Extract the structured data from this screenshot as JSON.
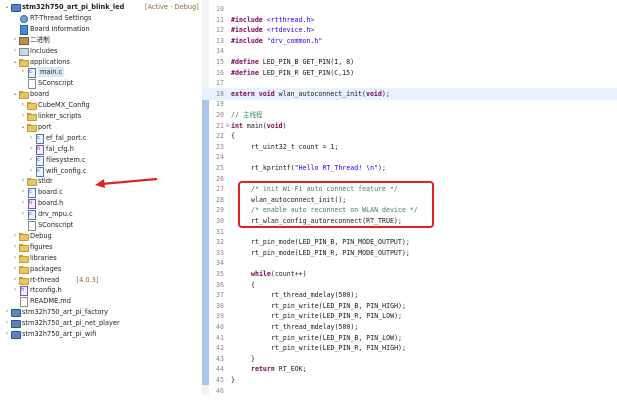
{
  "colors": {
    "selection": "#dbe7f5",
    "annotation_red": "#e02121",
    "keyword": "#7f0055",
    "string": "#2a00ff",
    "comment": "#3f7f5f",
    "current_line": "#e8f2fe"
  },
  "explorer": {
    "rows": [
      {
        "depth": 0,
        "twisty": "open",
        "icon": "project-icon",
        "label": "stm32h750_art_pi_blink_led",
        "extra": "[Active - Debug]",
        "bold": true
      },
      {
        "depth": 1,
        "twisty": "",
        "icon": "gear-icon",
        "label": "RT-Thread Settings"
      },
      {
        "depth": 1,
        "twisty": "",
        "icon": "book-icon",
        "label": "Board Information"
      },
      {
        "depth": 1,
        "twisty": "closed",
        "icon": "binaries-icon",
        "label": "二进制"
      },
      {
        "depth": 1,
        "twisty": "closed",
        "icon": "includes-icon",
        "label": "Includes"
      },
      {
        "depth": 1,
        "twisty": "open",
        "icon": "folder-icon",
        "label": "applications"
      },
      {
        "depth": 2,
        "twisty": "closed",
        "icon": "c-file-icon",
        "label": "main.c",
        "selected": true
      },
      {
        "depth": 2,
        "twisty": "",
        "icon": "file-icon",
        "label": "SConscript"
      },
      {
        "depth": 1,
        "twisty": "open",
        "icon": "folder-icon",
        "label": "board"
      },
      {
        "depth": 2,
        "twisty": "closed",
        "icon": "folder-icon",
        "label": "CubeMX_Config"
      },
      {
        "depth": 2,
        "twisty": "closed",
        "icon": "folder-icon",
        "label": "linker_scripts"
      },
      {
        "depth": 2,
        "twisty": "open",
        "icon": "folder-icon",
        "label": "port"
      },
      {
        "depth": 3,
        "twisty": "closed",
        "icon": "c-file-icon",
        "label": "ef_fal_port.c"
      },
      {
        "depth": 3,
        "twisty": "closed",
        "icon": "h-file-icon",
        "label": "fal_cfg.h"
      },
      {
        "depth": 3,
        "twisty": "closed",
        "icon": "c-file-icon",
        "label": "filesystem.c"
      },
      {
        "depth": 3,
        "twisty": "closed",
        "icon": "c-file-icon",
        "label": "wifi_config.c"
      },
      {
        "depth": 2,
        "twisty": "closed",
        "icon": "folder-icon",
        "label": "stldr"
      },
      {
        "depth": 2,
        "twisty": "closed",
        "icon": "c-file-icon",
        "label": "board.c"
      },
      {
        "depth": 2,
        "twisty": "closed",
        "icon": "h-file-icon",
        "label": "board.h"
      },
      {
        "depth": 2,
        "twisty": "closed",
        "icon": "c-file-icon",
        "label": "drv_mpu.c"
      },
      {
        "depth": 2,
        "twisty": "",
        "icon": "file-icon",
        "label": "SConscript"
      },
      {
        "depth": 1,
        "twisty": "closed",
        "icon": "folder-icon",
        "label": "Debug"
      },
      {
        "depth": 1,
        "twisty": "closed",
        "icon": "folder-icon",
        "label": "figures"
      },
      {
        "depth": 1,
        "twisty": "closed",
        "icon": "folder-icon",
        "label": "libraries"
      },
      {
        "depth": 1,
        "twisty": "closed",
        "icon": "folder-icon",
        "label": "packages"
      },
      {
        "depth": 1,
        "twisty": "closed",
        "icon": "folder-icon",
        "label": "rt-thread",
        "extra": "[4.0.3]"
      },
      {
        "depth": 1,
        "twisty": "closed",
        "icon": "h-file-icon",
        "label": "rtconfig.h"
      },
      {
        "depth": 1,
        "twisty": "",
        "icon": "file-icon",
        "label": "README.md"
      },
      {
        "depth": 0,
        "twisty": "closed",
        "icon": "project-icon",
        "label": "stm32h750_art_pi_factory"
      },
      {
        "depth": 0,
        "twisty": "closed",
        "icon": "project-icon",
        "label": "stm32h750_art_pi_net_player"
      },
      {
        "depth": 0,
        "twisty": "closed",
        "icon": "project-icon",
        "label": "stm32h750_art_pi_wifi"
      }
    ]
  },
  "editor": {
    "lines": [
      {
        "n": "10",
        "fold": "",
        "indent": 0,
        "parts": []
      },
      {
        "n": "11",
        "fold": "",
        "indent": 0,
        "parts": [
          {
            "t": "#include ",
            "c": "kw"
          },
          {
            "t": "<rtthread.h>",
            "c": "str"
          }
        ]
      },
      {
        "n": "12",
        "fold": "",
        "indent": 0,
        "parts": [
          {
            "t": "#include ",
            "c": "kw"
          },
          {
            "t": "<rtdevice.h>",
            "c": "str"
          }
        ]
      },
      {
        "n": "13",
        "fold": "",
        "indent": 0,
        "parts": [
          {
            "t": "#include ",
            "c": "kw"
          },
          {
            "t": "\"drv_common.h\"",
            "c": "str"
          }
        ]
      },
      {
        "n": "14",
        "fold": "",
        "indent": 0,
        "parts": []
      },
      {
        "n": "15",
        "fold": "",
        "indent": 0,
        "parts": [
          {
            "t": "#define ",
            "c": "kw"
          },
          {
            "t": "LED_PIN_B GET_PIN(I, 8)",
            "c": ""
          }
        ]
      },
      {
        "n": "16",
        "fold": "",
        "indent": 0,
        "parts": [
          {
            "t": "#define ",
            "c": "kw"
          },
          {
            "t": "LED_PIN_R GET_PIN(C,15)",
            "c": ""
          }
        ]
      },
      {
        "n": "17",
        "fold": "",
        "indent": 0,
        "parts": []
      },
      {
        "n": "18",
        "fold": "",
        "indent": 0,
        "current": true,
        "parts": [
          {
            "t": "extern void ",
            "c": "kw"
          },
          {
            "t": "wlan_autoconnect_init(",
            "c": ""
          },
          {
            "t": "void",
            "c": "kw"
          },
          {
            "t": ");",
            "c": ""
          }
        ]
      },
      {
        "n": "19",
        "fold": "",
        "indent": 0,
        "parts": []
      },
      {
        "n": "20",
        "fold": "",
        "indent": 0,
        "parts": [
          {
            "t": "// 主线程",
            "c": "cmt"
          }
        ]
      },
      {
        "n": "21",
        "fold": "⊖",
        "indent": 0,
        "parts": [
          {
            "t": "int ",
            "c": "kw"
          },
          {
            "t": "main(",
            "c": ""
          },
          {
            "t": "void",
            "c": "kw"
          },
          {
            "t": ")",
            "c": ""
          }
        ]
      },
      {
        "n": "22",
        "fold": "",
        "indent": 0,
        "parts": [
          {
            "t": "{",
            "c": ""
          }
        ]
      },
      {
        "n": "23",
        "fold": "",
        "indent": 1,
        "parts": [
          {
            "t": "rt_uint32_t count = 1;",
            "c": ""
          }
        ]
      },
      {
        "n": "24",
        "fold": "",
        "indent": 0,
        "parts": []
      },
      {
        "n": "25",
        "fold": "",
        "indent": 1,
        "parts": [
          {
            "t": "rt_kprintf(",
            "c": ""
          },
          {
            "t": "\"Hello RT_Thread! \\n\"",
            "c": "str"
          },
          {
            "t": ");",
            "c": ""
          }
        ]
      },
      {
        "n": "26",
        "fold": "",
        "indent": 0,
        "parts": []
      },
      {
        "n": "27",
        "fold": "",
        "indent": 1,
        "parts": [
          {
            "t": "/* init Wi-Fi auto connect feature */",
            "c": "cmt"
          }
        ]
      },
      {
        "n": "28",
        "fold": "",
        "indent": 1,
        "parts": [
          {
            "t": "wlan_autoconnect_init();",
            "c": ""
          }
        ]
      },
      {
        "n": "29",
        "fold": "",
        "indent": 1,
        "parts": [
          {
            "t": "/* enable auto reconnect on WLAN device */",
            "c": "cmt"
          }
        ]
      },
      {
        "n": "30",
        "fold": "",
        "indent": 1,
        "parts": [
          {
            "t": "rt_wlan_config_autoreconnect(RT_TRUE);",
            "c": ""
          }
        ]
      },
      {
        "n": "31",
        "fold": "",
        "indent": 0,
        "parts": []
      },
      {
        "n": "32",
        "fold": "",
        "indent": 1,
        "parts": [
          {
            "t": "rt_pin_mode(LED_PIN_B, PIN_MODE_OUTPUT);",
            "c": ""
          }
        ]
      },
      {
        "n": "33",
        "fold": "",
        "indent": 1,
        "parts": [
          {
            "t": "rt_pin_mode(LED_PIN_R, PIN_MODE_OUTPUT);",
            "c": ""
          }
        ]
      },
      {
        "n": "34",
        "fold": "",
        "indent": 0,
        "parts": []
      },
      {
        "n": "35",
        "fold": "",
        "indent": 1,
        "parts": [
          {
            "t": "while",
            "c": "kw"
          },
          {
            "t": "(count++)",
            "c": ""
          }
        ]
      },
      {
        "n": "36",
        "fold": "",
        "indent": 1,
        "parts": [
          {
            "t": "{",
            "c": ""
          }
        ]
      },
      {
        "n": "37",
        "fold": "",
        "indent": 2,
        "parts": [
          {
            "t": "rt_thread_mdelay(500);",
            "c": ""
          }
        ]
      },
      {
        "n": "38",
        "fold": "",
        "indent": 2,
        "parts": [
          {
            "t": "rt_pin_write(LED_PIN_B, PIN_HIGH);",
            "c": ""
          }
        ]
      },
      {
        "n": "39",
        "fold": "",
        "indent": 2,
        "parts": [
          {
            "t": "rt_pin_write(LED_PIN_R, PIN_LOW);",
            "c": ""
          }
        ]
      },
      {
        "n": "40",
        "fold": "",
        "indent": 2,
        "parts": [
          {
            "t": "rt_thread_mdelay(500);",
            "c": ""
          }
        ]
      },
      {
        "n": "41",
        "fold": "",
        "indent": 2,
        "parts": [
          {
            "t": "rt_pin_write(LED_PIN_B, PIN_LOW);",
            "c": ""
          }
        ]
      },
      {
        "n": "42",
        "fold": "",
        "indent": 2,
        "parts": [
          {
            "t": "rt_pin_write(LED_PIN_R, PIN_HIGH);",
            "c": ""
          }
        ]
      },
      {
        "n": "43",
        "fold": "",
        "indent": 1,
        "parts": [
          {
            "t": "}",
            "c": ""
          }
        ]
      },
      {
        "n": "44",
        "fold": "",
        "indent": 1,
        "parts": [
          {
            "t": "return ",
            "c": "kw"
          },
          {
            "t": "RT_EOK;",
            "c": ""
          }
        ]
      },
      {
        "n": "45",
        "fold": "",
        "indent": 0,
        "parts": [
          {
            "t": "}",
            "c": ""
          }
        ]
      },
      {
        "n": "46",
        "fold": "",
        "indent": 0,
        "parts": []
      }
    ]
  }
}
